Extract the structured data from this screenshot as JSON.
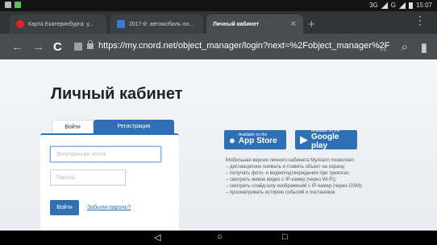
{
  "status_bar": {
    "network": "3G",
    "signal_label": "G",
    "time": "15:07"
  },
  "browser": {
    "tabs": [
      {
        "label": "Карта Екатеринбурга: у...",
        "icon": "yandex-icon"
      },
      {
        "label": "2017-й: автомобиль он...",
        "icon": "auto-icon"
      },
      {
        "label": "Личный кабинет",
        "icon": "none"
      }
    ],
    "url_prefix": "https://",
    "url_rest": "my.cnord.net/object_manager/login?next=%2Fobject_manager%2F"
  },
  "page": {
    "title": "Личный кабинет",
    "tab_login": "Войти",
    "tab_register": "Регистрация",
    "email_placeholder": "Электронная почта",
    "password_placeholder": "Пароль",
    "login_button": "Войти",
    "forgot_password": "Забыли пароль?",
    "app_store": {
      "small": "Available on the",
      "big": "App Store"
    },
    "google_play": {
      "small": "Available on the",
      "big": "Google play"
    },
    "description": [
      "Мобильная версия личного кабинета MyAlarm позволяет:",
      "– дистанционно снимать и ставить объект на охрану;",
      "– получать фото- и видеоподтверждения при тревогах;",
      "– смотреть живое видео с IP-камер (через Wi-Fi);",
      "– смотреть слайд-шоу изображений с IP-камер (через GSM);",
      "– просматривать историю событий и постановок."
    ]
  },
  "colors": {
    "accent": "#2f6fb3",
    "toolbar": "#474d50",
    "tabstrip": "#2f3436"
  }
}
